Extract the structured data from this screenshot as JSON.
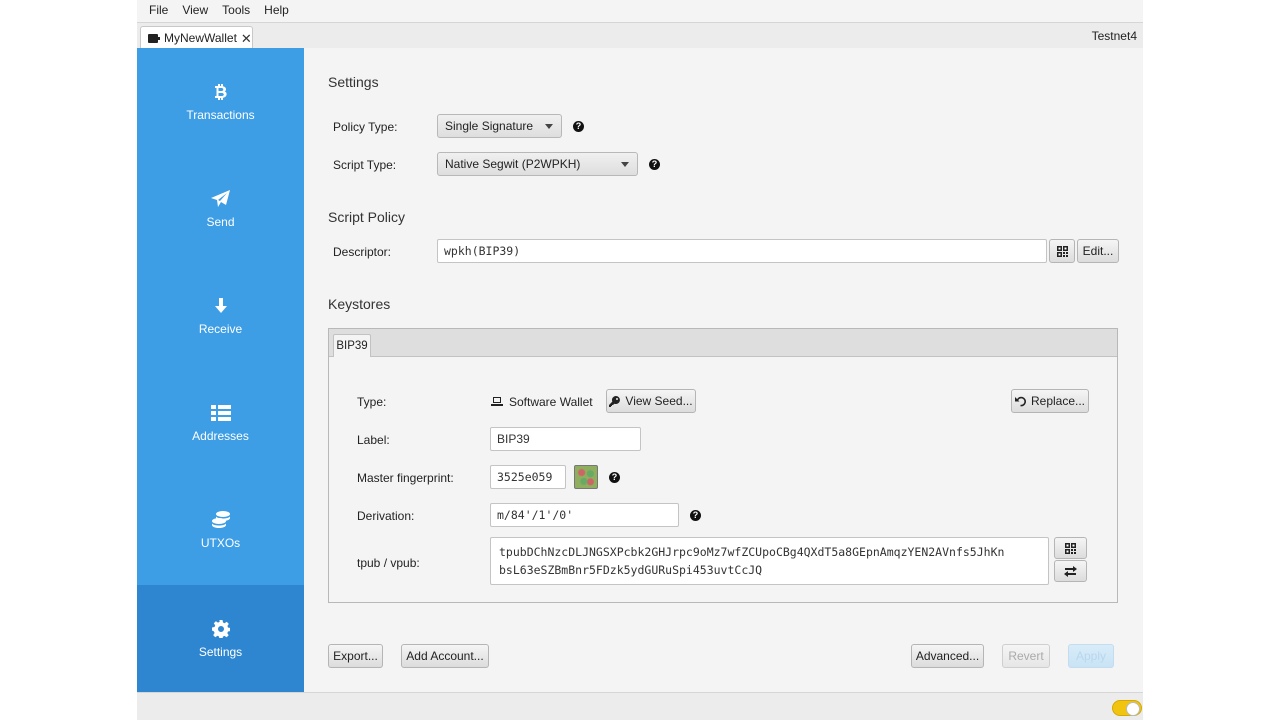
{
  "menu": [
    "File",
    "View",
    "Tools",
    "Help"
  ],
  "wallet_tab": {
    "label": "MyNewWallet",
    "close": "✕"
  },
  "network": "Testnet4",
  "sidebar": {
    "items": [
      {
        "label": "Transactions",
        "icon": "bitcoin-icon"
      },
      {
        "label": "Send",
        "icon": "paper-plane-icon"
      },
      {
        "label": "Receive",
        "icon": "arrow-down-icon"
      },
      {
        "label": "Addresses",
        "icon": "list-icon"
      },
      {
        "label": "UTXOs",
        "icon": "coins-icon"
      },
      {
        "label": "Settings",
        "icon": "gear-icon",
        "active": true
      }
    ]
  },
  "settings": {
    "title": "Settings",
    "policy_type_label": "Policy Type:",
    "policy_type_value": "Single Signature",
    "script_type_label": "Script Type:",
    "script_type_value": "Native Segwit (P2WPKH)"
  },
  "script_policy": {
    "title": "Script Policy",
    "descriptor_label": "Descriptor:",
    "descriptor_value": "wpkh(BIP39)",
    "edit_label": "Edit..."
  },
  "keystores": {
    "title": "Keystores",
    "tab_label": "BIP39",
    "type_label": "Type:",
    "type_value": "Software Wallet",
    "view_seed_label": "View Seed...",
    "replace_label": "Replace...",
    "label_label": "Label:",
    "label_value": "BIP39",
    "fingerprint_label": "Master fingerprint:",
    "fingerprint_value": "3525e059",
    "derivation_label": "Derivation:",
    "derivation_value": "m/84'/1'/0'",
    "xpub_label": "tpub / vpub:",
    "xpub_value": "tpubDChNzcDLJNGSXPcbk2GHJrpc9oMz7wfZCUpoCBg4QXdT5a8GEpnAmqzYEN2AVnfs5JhKn\nbsL63eSZBmBnr5FDzk5ydGURuSpi453uvtCcJQ"
  },
  "footer": {
    "export_label": "Export...",
    "add_account_label": "Add Account...",
    "advanced_label": "Advanced...",
    "revert_label": "Revert",
    "apply_label": "Apply"
  },
  "help_glyph": "?"
}
